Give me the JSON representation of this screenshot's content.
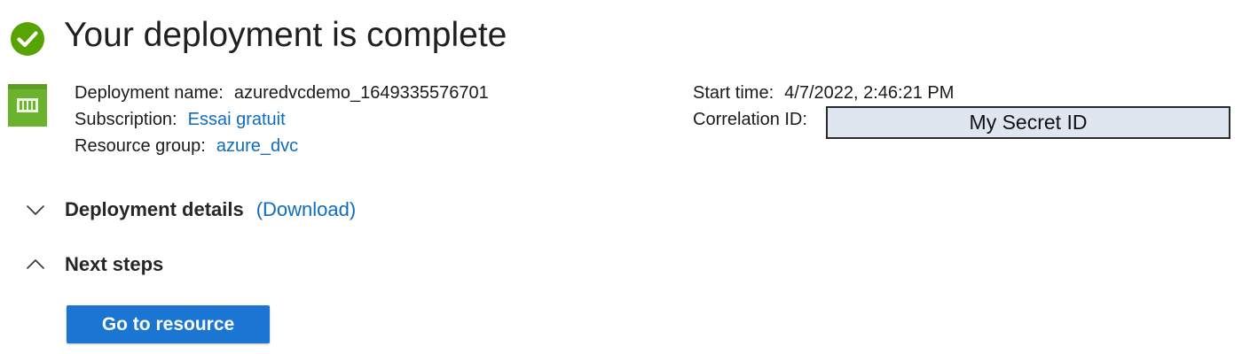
{
  "header": {
    "title": "Your deployment is complete",
    "status_icon": "check-circle-icon",
    "status_color": "#57a300"
  },
  "resource_icon": "deployment-icon",
  "details": {
    "deployment_name": {
      "label": "Deployment name:",
      "value": "azuredvcdemo_1649335576701"
    },
    "subscription": {
      "label": "Subscription:",
      "value": "Essai gratuit"
    },
    "resource_group": {
      "label": "Resource group:",
      "value": "azure_dvc"
    },
    "start_time": {
      "label": "Start time:",
      "value": "4/7/2022, 2:46:21 PM"
    },
    "correlation_id": {
      "label": "Correlation ID:",
      "value": "My Secret ID"
    }
  },
  "sections": {
    "deployment_details": {
      "title": "Deployment details",
      "download_label": "(Download)",
      "expanded": false
    },
    "next_steps": {
      "title": "Next steps",
      "expanded": true
    }
  },
  "actions": {
    "go_to_resource_label": "Go to resource"
  },
  "colors": {
    "link": "#0f6cbd",
    "primary_button": "#1a76d2",
    "success": "#57a300",
    "redaction_fill": "#dfe6ef"
  }
}
